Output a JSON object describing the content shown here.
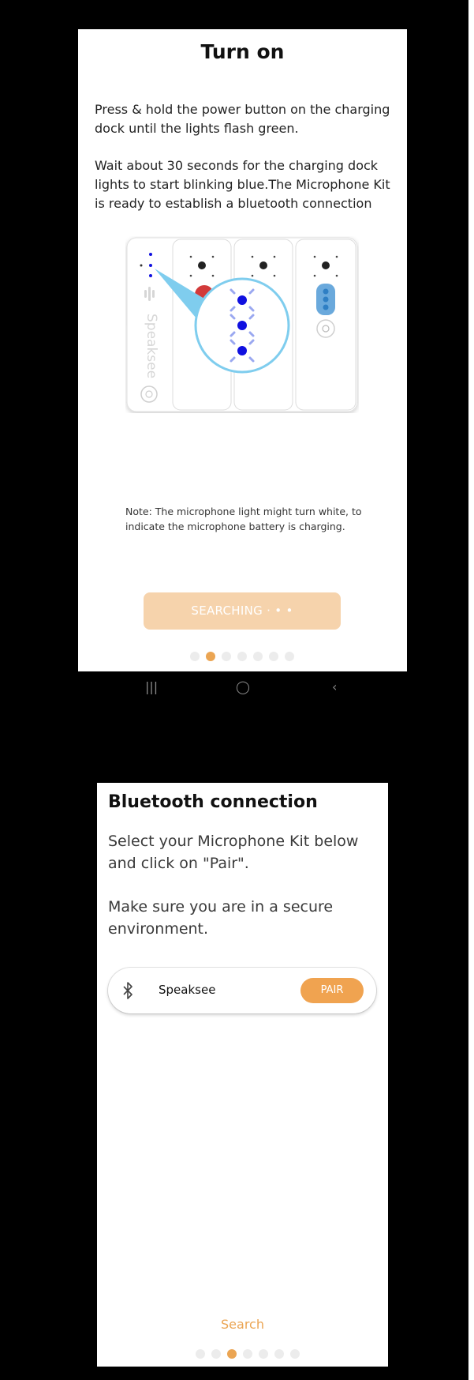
{
  "screen1": {
    "title": "Turn on",
    "para1": "Press & hold the power button on the charging dock until the lights flash green.",
    "para2": "Wait about 30 seconds for the charging dock lights to start blinking blue.The Microphone Kit is ready to establish a bluetooth connection",
    "illustration": {
      "brand_label": "Speaksee",
      "led_color": "#1010e0",
      "magnifier_color": "#7fcdee",
      "mic_red": "#d23a3a",
      "mic_blue": "#6aa9dc"
    },
    "note": "Note: The microphone light might turn white, to indicate the microphone battery is charging.",
    "searching_label": "SEARCHING",
    "searching_suffix": "· • •",
    "page_dots": {
      "count": 7,
      "active_index": 1
    }
  },
  "navbar": {
    "icons": [
      "recent-apps-icon",
      "home-icon",
      "back-icon"
    ],
    "recent": "|||",
    "home": "◯",
    "back": "‹"
  },
  "screen2": {
    "title": "Bluetooth connection",
    "para1": "Select your Microphone Kit below and click on \"Pair\".",
    "para2": "Make sure you are in a secure environment.",
    "device": {
      "name": "Speaksee",
      "pair_label": "PAIR",
      "icon": "bluetooth-icon"
    },
    "search_label": "Search",
    "page_dots": {
      "count": 7,
      "active_index": 2
    }
  },
  "colors": {
    "accent": "#eba553",
    "accent_disabled": "#f6d3ac",
    "background": "#000000"
  }
}
